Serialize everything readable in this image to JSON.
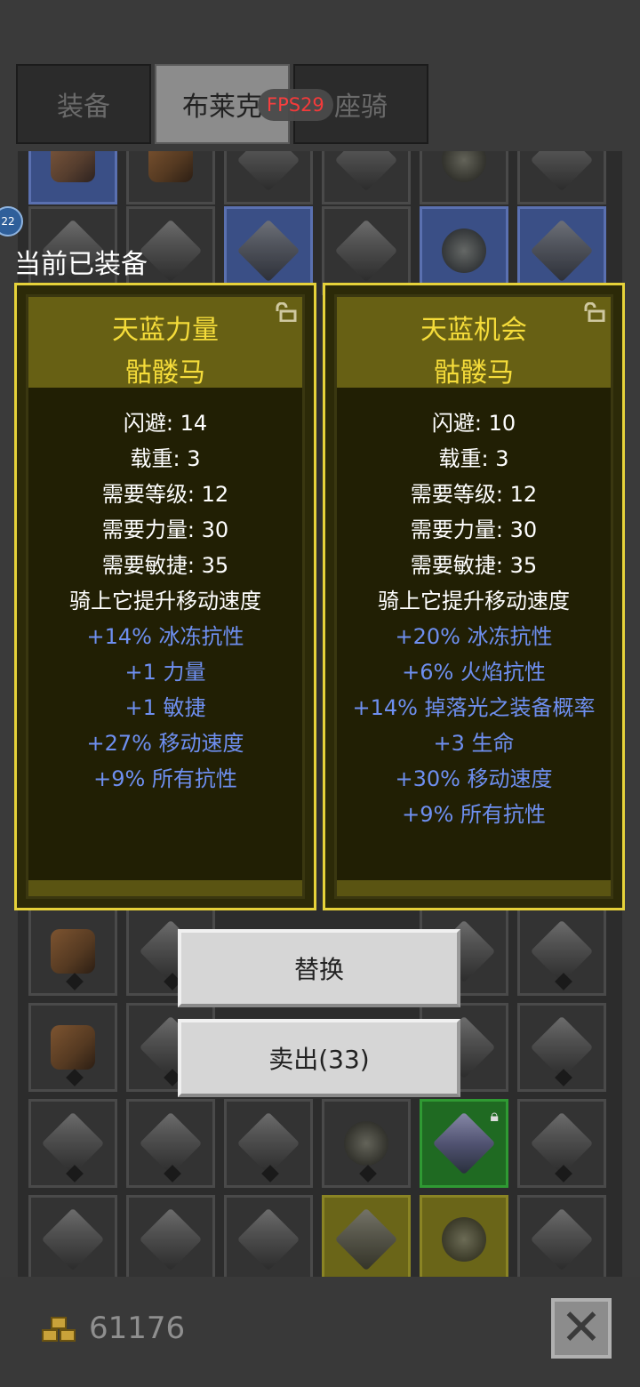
{
  "tabs": [
    {
      "label": "装备",
      "active": false
    },
    {
      "label": "布莱克",
      "active": true
    },
    {
      "label": "座骑",
      "active": false
    }
  ],
  "fps": "FPS29",
  "badge": "22",
  "equipped_label": "当前已装备",
  "left_panel": {
    "title": "天蓝力量",
    "subtitle": "骷髅马",
    "stats": [
      "闪避: 14",
      "载重: 3",
      "需要等级: 12",
      "需要力量: 30",
      "需要敏捷: 35",
      "骑上它提升移动速度"
    ],
    "magic": [
      "+14% 冰冻抗性",
      "+1 力量",
      "+1 敏捷",
      "+27% 移动速度",
      "+9% 所有抗性"
    ]
  },
  "right_panel": {
    "title": "天蓝机会",
    "subtitle": "骷髅马",
    "stats": [
      "闪避: 10",
      "载重: 3",
      "需要等级: 12",
      "需要力量: 30",
      "需要敏捷: 35",
      "骑上它提升移动速度"
    ],
    "magic": [
      "+20% 冰冻抗性",
      "+6% 火焰抗性",
      "+14% 掉落光之装备概率",
      "+3 生命",
      "+30% 移动速度",
      "+9% 所有抗性"
    ]
  },
  "buttons": {
    "replace": "替换",
    "sell": "卖出(33)"
  },
  "gold": "61176",
  "colors": {
    "title_yellow": "#f5dc3a",
    "magic_blue": "#6e8ff0",
    "panel_border": "#e6d23a"
  }
}
